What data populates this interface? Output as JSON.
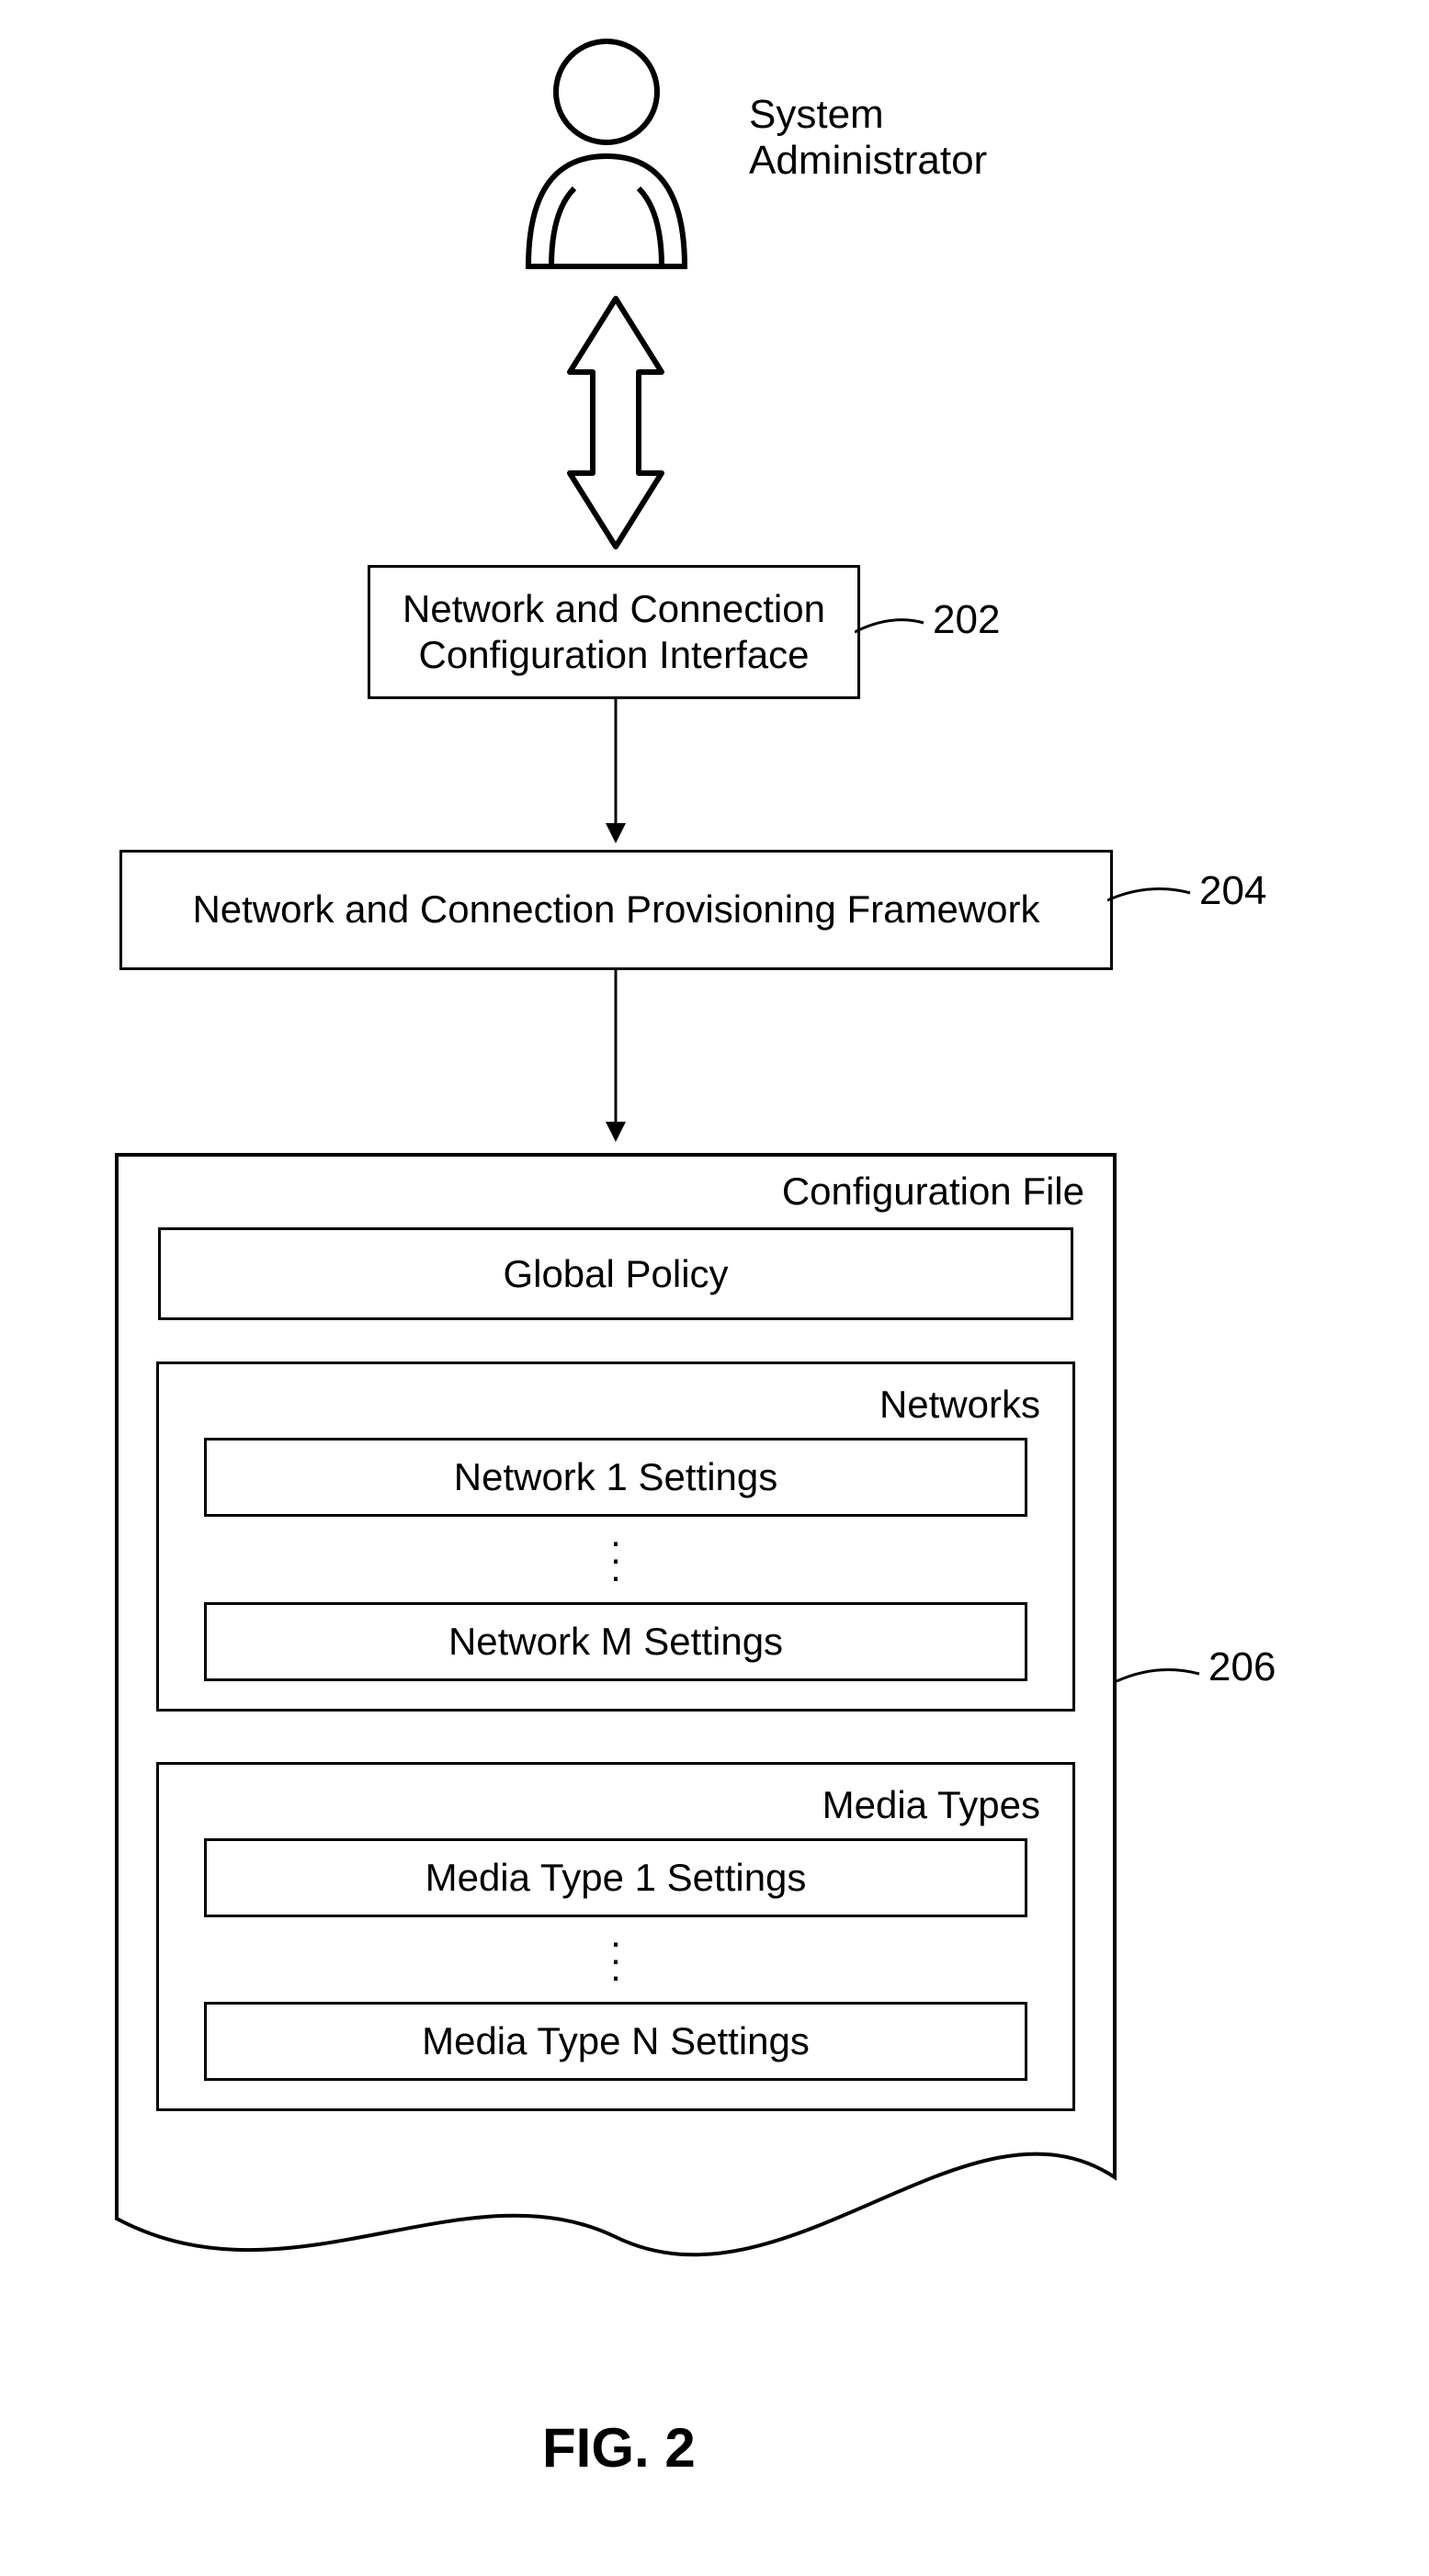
{
  "actor_label": "System\nAdministrator",
  "box_202": "Network and Connection\nConfiguration Interface",
  "ref_202": "202",
  "box_204": "Network and Connection Provisioning Framework",
  "ref_204": "204",
  "ref_206": "206",
  "config_file_label": "Configuration File",
  "global_policy_label": "Global Policy",
  "networks": {
    "title": "Networks",
    "first": "Network 1 Settings",
    "last": "Network M Settings"
  },
  "media": {
    "title": "Media Types",
    "first": "Media Type 1 Settings",
    "last": "Media Type N Settings"
  },
  "figure_label": "FIG. 2"
}
